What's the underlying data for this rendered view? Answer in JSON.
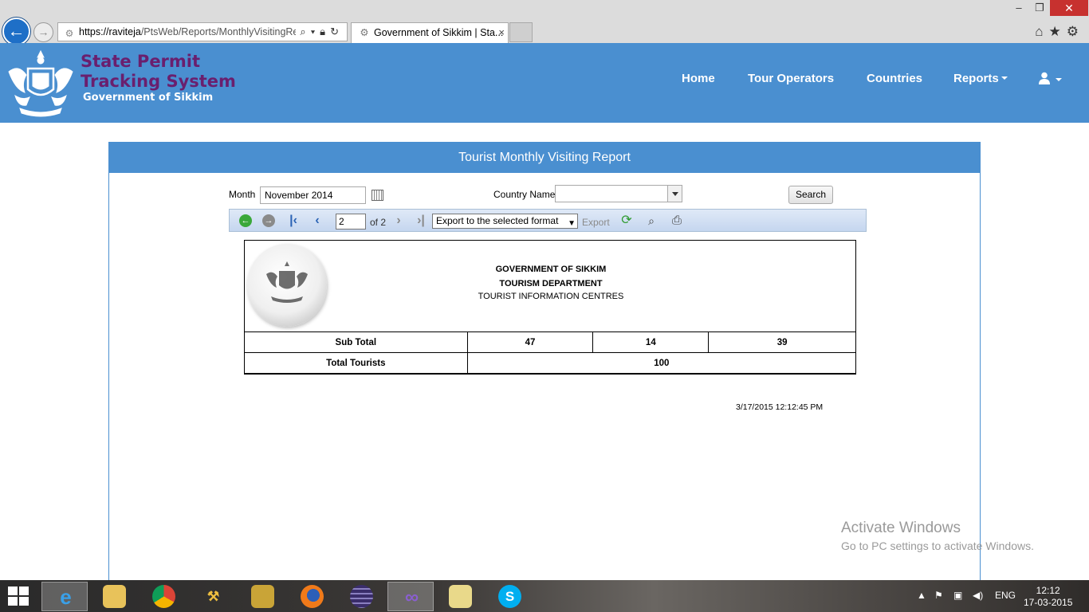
{
  "browser": {
    "url_prefix": "https://raviteja",
    "url_path": "/PtsWeb/Reports/MonthlyVisitingRe",
    "tab_title": "Government of Sikkim | Sta...",
    "tab_close": "×",
    "back_glyph": "←",
    "forward_glyph": "→",
    "window_controls": [
      "–",
      "❐",
      "✕"
    ],
    "toolbar_glyphs": [
      "⌂",
      "★",
      "⚙"
    ]
  },
  "site": {
    "title_line1": "State Permit",
    "title_line2": "Tracking System",
    "subtitle": "Government of Sikkim",
    "nav": {
      "home": "Home",
      "tour_operators": "Tour Operators",
      "countries": "Countries",
      "reports": "Reports"
    }
  },
  "panel": {
    "title": "Tourist Monthly Visiting Report",
    "month_label": "Month",
    "month_value": "November 2014",
    "country_label": "Country Name",
    "country_value": "",
    "search_label": "Search"
  },
  "report_toolbar": {
    "page_value": "2",
    "page_of": "of 2",
    "export_format": "Export to the selected format",
    "export_label": "Export"
  },
  "report": {
    "line1": "GOVERNMENT OF SIKKIM",
    "line2": "TOURISM DEPARTMENT",
    "line3": "TOURIST INFORMATION CENTRES",
    "rows": [
      {
        "label": "Sub Total",
        "values": [
          "47",
          "14",
          "39"
        ]
      },
      {
        "label": "Total Tourists",
        "total": "100"
      }
    ],
    "timestamp": "3/17/2015 12:12:45 PM"
  },
  "watermark": {
    "line1": "Activate Windows",
    "line2": "Go to PC settings to activate Windows."
  },
  "taskbar": {
    "lang": "ENG",
    "time": "12:12",
    "date": "17-03-2015"
  },
  "colors": {
    "header_blue": "#4a8fd0",
    "brand_purple": "#6a1f6e"
  }
}
